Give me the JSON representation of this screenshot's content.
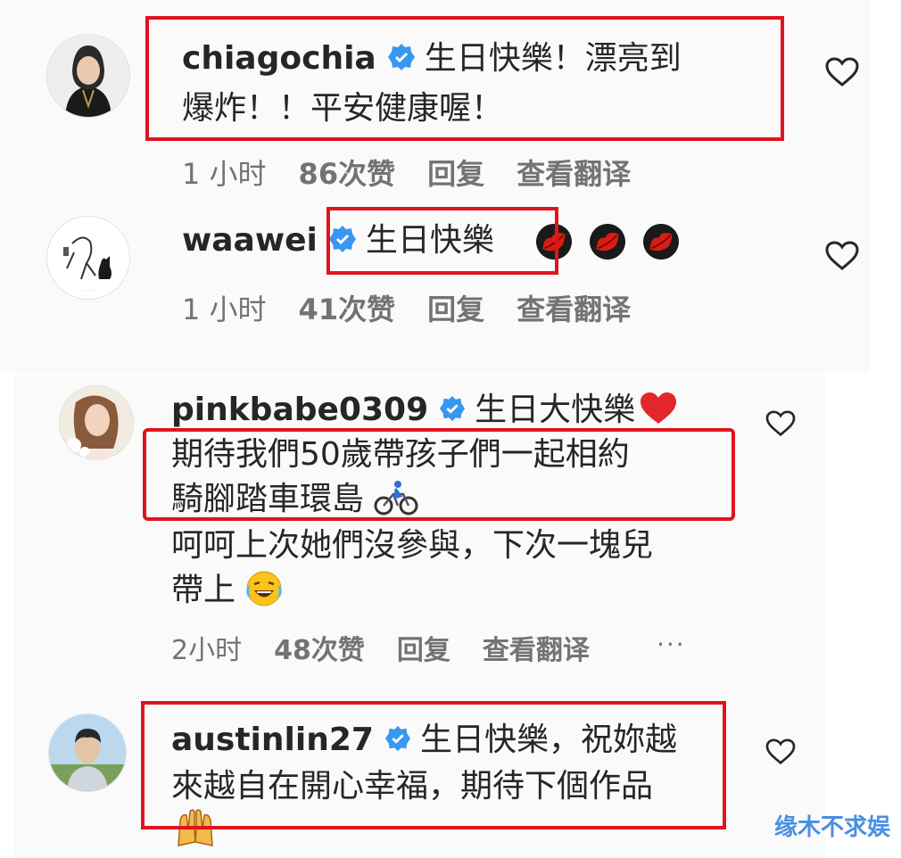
{
  "comments": [
    {
      "username": "chiagochia",
      "text_line1": "生日快樂！漂亮到",
      "text_line2": "爆炸！！平安健康喔！",
      "time": "1 小时",
      "likes": "86次赞",
      "reply": "回复",
      "translate": "查看翻译"
    },
    {
      "username": "waawei",
      "text_line1": "生日快樂",
      "time": "1 小时",
      "likes": "41次赞",
      "reply": "回复",
      "translate": "查看翻译"
    },
    {
      "username": "pinkbabe0309",
      "text_line1": "生日大快樂",
      "text_line2": "期待我們50歲帶孩子們一起相約",
      "text_line3": "騎腳踏車環島",
      "text_line4": "呵呵上次她們沒參與，下次一塊兒",
      "text_line5": "帶上",
      "time": "2小时",
      "likes": "48次赞",
      "reply": "回复",
      "translate": "查看翻译",
      "more": "···"
    },
    {
      "username": "austinlin27",
      "text_line1": "生日快樂，祝妳越",
      "text_line2": "來越自在開心幸福，期待下個作品"
    }
  ],
  "watermark": "缘木不求娱",
  "colors": {
    "highlight_box": "#e0141e",
    "verified_badge": "#3897f0",
    "meta_text": "#737373"
  },
  "icons": [
    "verified-icon",
    "heart-icon",
    "lips-emoji",
    "red-heart-emoji",
    "cyclist-emoji",
    "laughing-emoji",
    "raised-hands-emoji"
  ]
}
